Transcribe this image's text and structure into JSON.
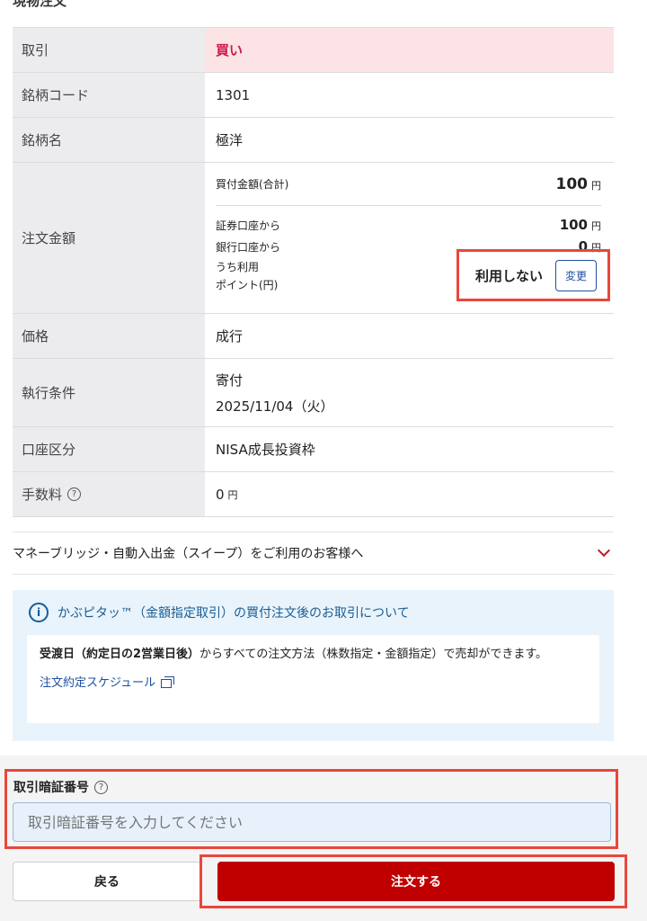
{
  "header": {
    "title": "現物注文"
  },
  "order": {
    "trade": {
      "label": "取引",
      "value": "買い"
    },
    "code": {
      "label": "銘柄コード",
      "value": "1301"
    },
    "name": {
      "label": "銘柄名",
      "value": "極洋"
    },
    "amount": {
      "label": "注文金額",
      "total_label": "買付金額(合計)",
      "total_value": "100",
      "securities_label": "証券口座から",
      "securities_value": "100",
      "bank_label": "銀行口座から",
      "bank_value": "0",
      "point_label_1": "うち利用",
      "point_label_2": "ポイント(円)",
      "point_status": "利用しない",
      "change_label": "変更",
      "unit": "円"
    },
    "price": {
      "label": "価格",
      "value": "成行"
    },
    "condition": {
      "label": "執行条件",
      "value": "寄付",
      "date": "2025/11/04（火）"
    },
    "account": {
      "label": "口座区分",
      "value": "NISA成長投資枠"
    },
    "fee": {
      "label": "手数料",
      "value": "0",
      "unit": "円"
    }
  },
  "sweep": {
    "label": "マネーブリッジ・自動入出金（スイープ）をご利用のお客様へ"
  },
  "info": {
    "title": "かぶピタッ™（金額指定取引）の買付注文後のお取引について",
    "body_bold": "受渡日（約定日の2営業日後）",
    "body_rest": "からすべての注文方法（株数指定・金額指定）で売却ができます。",
    "link": "注文約定スケジュール"
  },
  "pin": {
    "label": "取引暗証番号",
    "placeholder": "取引暗証番号を入力してください"
  },
  "actions": {
    "back": "戻る",
    "submit": "注文する"
  },
  "colors": {
    "buy": "#d0194a",
    "submit": "#c00000",
    "highlight": "#e8473b",
    "link": "#1f4fa0"
  }
}
